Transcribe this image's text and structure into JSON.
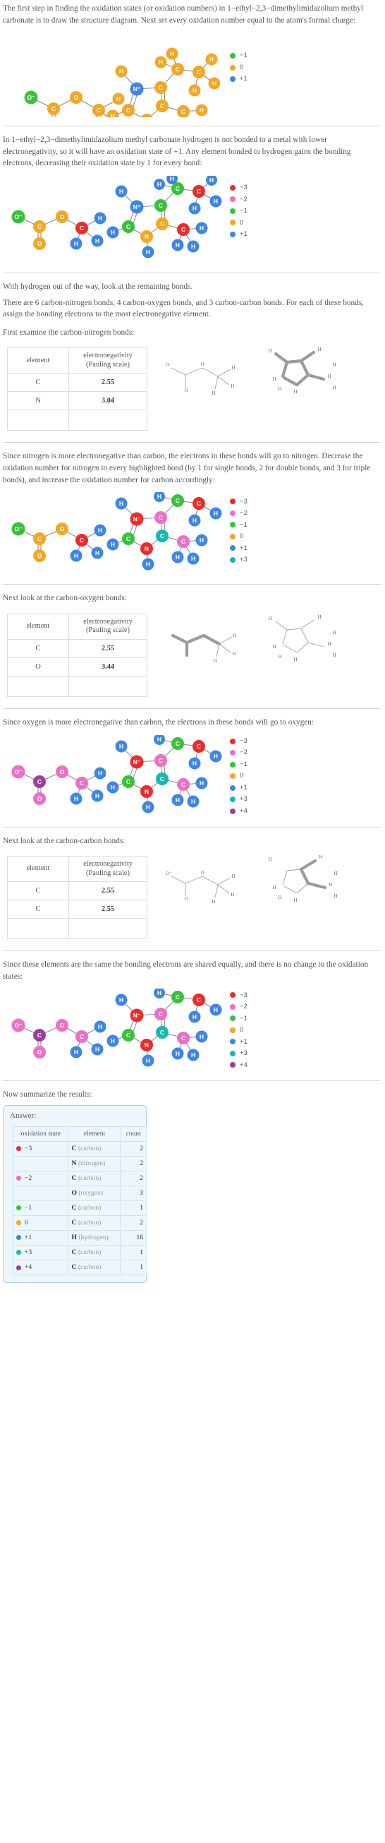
{
  "colors": {
    "m3": "#ee2b2b",
    "m2": "#ee6fc4",
    "m1": "#37c23a",
    "z0": "#f5a623",
    "p1": "#3d86e8",
    "p3": "#17b8b0",
    "p4": "#9b3fa0",
    "carbon_text": "#ffffff",
    "answer_border": "#9fd3e8",
    "answer_bg": "#edf7fb"
  },
  "steps": {
    "step1": "The first step in finding the oxidation states (or oxidation numbers) in 1−ethyl−2,3−dimethylimidazolium methyl carbonate is to draw the structure diagram. Next set every oxidation number equal to the atom's formal charge:",
    "step2": "In 1−ethyl−2,3−dimethylimidazolium methyl carbonate hydrogen is not bonded to a metal with lower electronegativity, so it will have an oxidation state of +1. Any element bonded to hydrogen gains the bonding electrons, decreasing their oxidation state by 1 for every bond:",
    "step3a": "With hydrogen out of the way, look at the remaining bonds.",
    "step3b": "There are 6 carbon-nitrogen bonds, 4 carbon-oxygen bonds, and 3 carbon-carbon bonds.  For each of these bonds, assign the bonding electrons to the most electronegative element.",
    "step3c": "First examine the carbon-nitrogen bonds:",
    "step4": "Since nitrogen is more electronegative than carbon, the electrons in these bonds will go to nitrogen. Decrease the oxidation number for nitrogen in every highlighted bond (by 1 for single bonds, 2 for double bonds, and 3 for triple bonds), and increase the oxidation number for carbon accordingly:",
    "step5": "Next look at the carbon-oxygen bonds:",
    "step6": "Since oxygen is more electronegative than carbon, the electrons in these bonds will go to oxygen:",
    "step7": "Next look at the carbon-carbon bonds:",
    "step8": "Since these elements are the same the bonding electrons are shared equally, and there is no change to the oxidation states:",
    "step9": "Now summarize the results:"
  },
  "en_tables": [
    {
      "header": {
        "c1": "element",
        "c2": "electronegativity (Pauling scale)"
      },
      "rows": [
        {
          "element": "C",
          "value": "2.55"
        },
        {
          "element": "N",
          "value": "3.04"
        }
      ]
    },
    {
      "header": {
        "c1": "element",
        "c2": "electronegativity (Pauling scale)"
      },
      "rows": [
        {
          "element": "C",
          "value": "2.55"
        },
        {
          "element": "O",
          "value": "3.44"
        }
      ]
    },
    {
      "header": {
        "c1": "element",
        "c2": "electronegativity (Pauling scale)"
      },
      "rows": [
        {
          "element": "C",
          "value": "2.55"
        },
        {
          "element": "C",
          "value": "2.55"
        }
      ]
    }
  ],
  "legends": {
    "legend1": [
      {
        "label": "-1",
        "color": "#37c23a"
      },
      {
        "label": "0",
        "color": "#f5a623"
      },
      {
        "label": "+1",
        "color": "#3d86e8"
      }
    ],
    "legend2": [
      {
        "label": "-3",
        "color": "#ee2b2b"
      },
      {
        "label": "-2",
        "color": "#ee6fc4"
      },
      {
        "label": "-1",
        "color": "#37c23a"
      },
      {
        "label": "0",
        "color": "#f5a623"
      },
      {
        "label": "+1",
        "color": "#3d86e8"
      }
    ],
    "legend3": [
      {
        "label": "-3",
        "color": "#ee2b2b"
      },
      {
        "label": "-2",
        "color": "#ee6fc4"
      },
      {
        "label": "-1",
        "color": "#37c23a"
      },
      {
        "label": "0",
        "color": "#f5a623"
      },
      {
        "label": "+1",
        "color": "#3d86e8"
      },
      {
        "label": "+3",
        "color": "#17b8b0"
      }
    ],
    "legend4": [
      {
        "label": "-3",
        "color": "#ee2b2b"
      },
      {
        "label": "-2",
        "color": "#ee6fc4"
      },
      {
        "label": "-1",
        "color": "#37c23a"
      },
      {
        "label": "0",
        "color": "#f5a623"
      },
      {
        "label": "+1",
        "color": "#3d86e8"
      },
      {
        "label": "+3",
        "color": "#17b8b0"
      },
      {
        "label": "+4",
        "color": "#9b3fa0"
      }
    ],
    "legend5": [
      {
        "label": "-3",
        "color": "#ee2b2b"
      },
      {
        "label": "-2",
        "color": "#ee6fc4"
      },
      {
        "label": "-1",
        "color": "#37c23a"
      },
      {
        "label": "0",
        "color": "#f5a623"
      },
      {
        "label": "+1",
        "color": "#3d86e8"
      },
      {
        "label": "+3",
        "color": "#17b8b0"
      },
      {
        "label": "+4",
        "color": "#9b3fa0"
      }
    ]
  },
  "answer": {
    "label": "Answer:",
    "columns": [
      "oxidation state",
      "element",
      "count"
    ],
    "rows": [
      {
        "state": "-3",
        "color": "#ee2b2b",
        "sym": "C",
        "name": "(carbon)",
        "count": "2",
        "first": true
      },
      {
        "state": "",
        "color": "",
        "sym": "N",
        "name": "(nitrogen)",
        "count": "2",
        "first": false
      },
      {
        "state": "-2",
        "color": "#ee6fc4",
        "sym": "C",
        "name": "(carbon)",
        "count": "2",
        "first": true
      },
      {
        "state": "",
        "color": "",
        "sym": "O",
        "name": "(oxygen)",
        "count": "3",
        "first": false
      },
      {
        "state": "-1",
        "color": "#37c23a",
        "sym": "C",
        "name": "(carbon)",
        "count": "1",
        "first": true
      },
      {
        "state": "0",
        "color": "#f5a623",
        "sym": "C",
        "name": "(carbon)",
        "count": "2",
        "first": true
      },
      {
        "state": "+1",
        "color": "#3d86e8",
        "sym": "H",
        "name": "(hydrogen)",
        "count": "16",
        "first": true
      },
      {
        "state": "+3",
        "color": "#17b8b0",
        "sym": "C",
        "name": "(carbon)",
        "count": "1",
        "first": true
      },
      {
        "state": "+4",
        "color": "#9b3fa0",
        "sym": "C",
        "name": "(carbon)",
        "count": "1",
        "first": true
      }
    ]
  },
  "molecules": {
    "m1_note": "carbonate anion + imidazolium cation, all atoms orange (0) except O- green (-1) and N+ blue (+1)",
    "m2_note": "hydrogens blue (+1), attached carbons/N shifted",
    "m3_note": "nitrogen reduced, carbons oxidized",
    "m4_note": "oxygen reduced, carbons oxidized",
    "m5_note": "carbon-carbon unchanged"
  }
}
